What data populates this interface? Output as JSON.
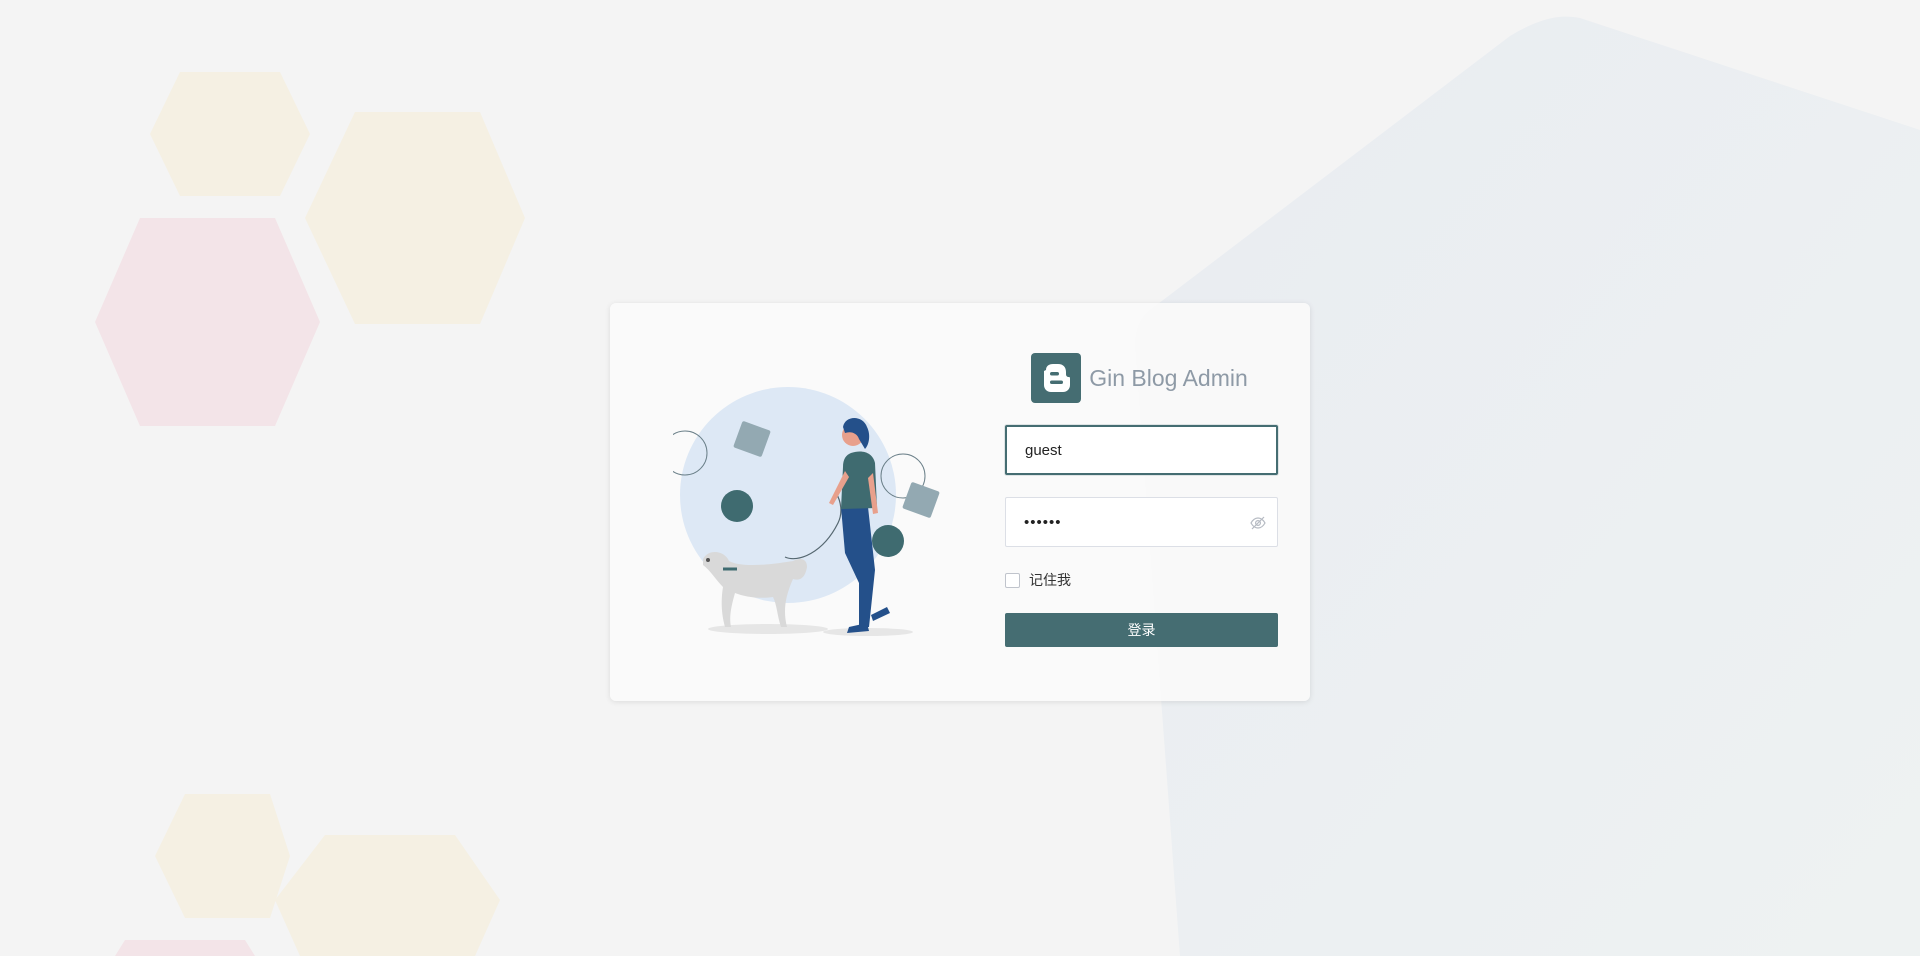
{
  "brand": {
    "title": "Gin Blog Admin",
    "logo_icon": "blogger-icon",
    "logo_color": "#456d72"
  },
  "login_form": {
    "username_value": "guest",
    "password_mask": "••••••",
    "password_toggle_icon": "eye-off-icon",
    "remember_label": "记住我",
    "remember_checked": false,
    "submit_label": "登录"
  },
  "colors": {
    "accent": "#456d72",
    "page_background": "#f4f4f4"
  }
}
